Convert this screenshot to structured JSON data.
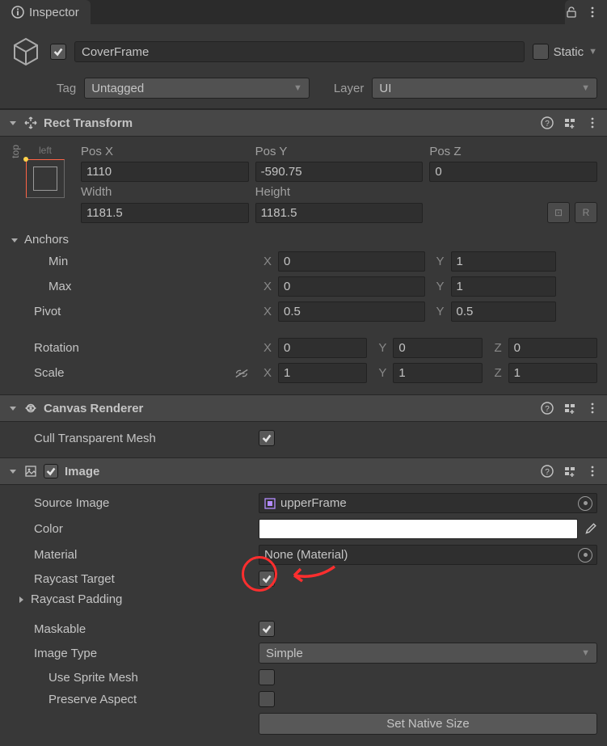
{
  "tab": {
    "title": "Inspector"
  },
  "header": {
    "active_checked": true,
    "name": "CoverFrame",
    "static_label": "Static",
    "static_checked": false,
    "tag_label": "Tag",
    "tag_value": "Untagged",
    "layer_label": "Layer",
    "layer_value": "UI"
  },
  "rect_transform": {
    "title": "Rect Transform",
    "pivot_anchor_left": "left",
    "pivot_anchor_top": "top",
    "labels": {
      "posx": "Pos X",
      "posy": "Pos Y",
      "posz": "Pos Z",
      "width": "Width",
      "height": "Height"
    },
    "posx": "1110",
    "posy": "-590.75",
    "posz": "0",
    "width": "1181.5",
    "height": "1181.5",
    "anchors_label": "Anchors",
    "min_label": "Min",
    "max_label": "Max",
    "min_x": "0",
    "min_y": "1",
    "max_x": "0",
    "max_y": "1",
    "pivot_label": "Pivot",
    "pivot_x": "0.5",
    "pivot_y": "0.5",
    "rotation_label": "Rotation",
    "rot_x": "0",
    "rot_y": "0",
    "rot_z": "0",
    "scale_label": "Scale",
    "scale_x": "1",
    "scale_y": "1",
    "scale_z": "1",
    "axis": {
      "x": "X",
      "y": "Y",
      "z": "Z"
    }
  },
  "canvas_renderer": {
    "title": "Canvas Renderer",
    "cull_label": "Cull Transparent Mesh",
    "cull_checked": true
  },
  "image": {
    "title": "Image",
    "enabled": true,
    "source_label": "Source Image",
    "source_value": "upperFrame",
    "color_label": "Color",
    "color_value": "#ffffff",
    "material_label": "Material",
    "material_value": "None (Material)",
    "raycast_target_label": "Raycast Target",
    "raycast_target_checked": true,
    "raycast_padding_label": "Raycast Padding",
    "maskable_label": "Maskable",
    "maskable_checked": true,
    "image_type_label": "Image Type",
    "image_type_value": "Simple",
    "use_sprite_mesh_label": "Use Sprite Mesh",
    "use_sprite_mesh_checked": false,
    "preserve_aspect_label": "Preserve Aspect",
    "preserve_aspect_checked": false,
    "set_native_size_label": "Set Native Size"
  },
  "tool_buttons": {
    "blueprint": "⊡",
    "raw": "R"
  }
}
